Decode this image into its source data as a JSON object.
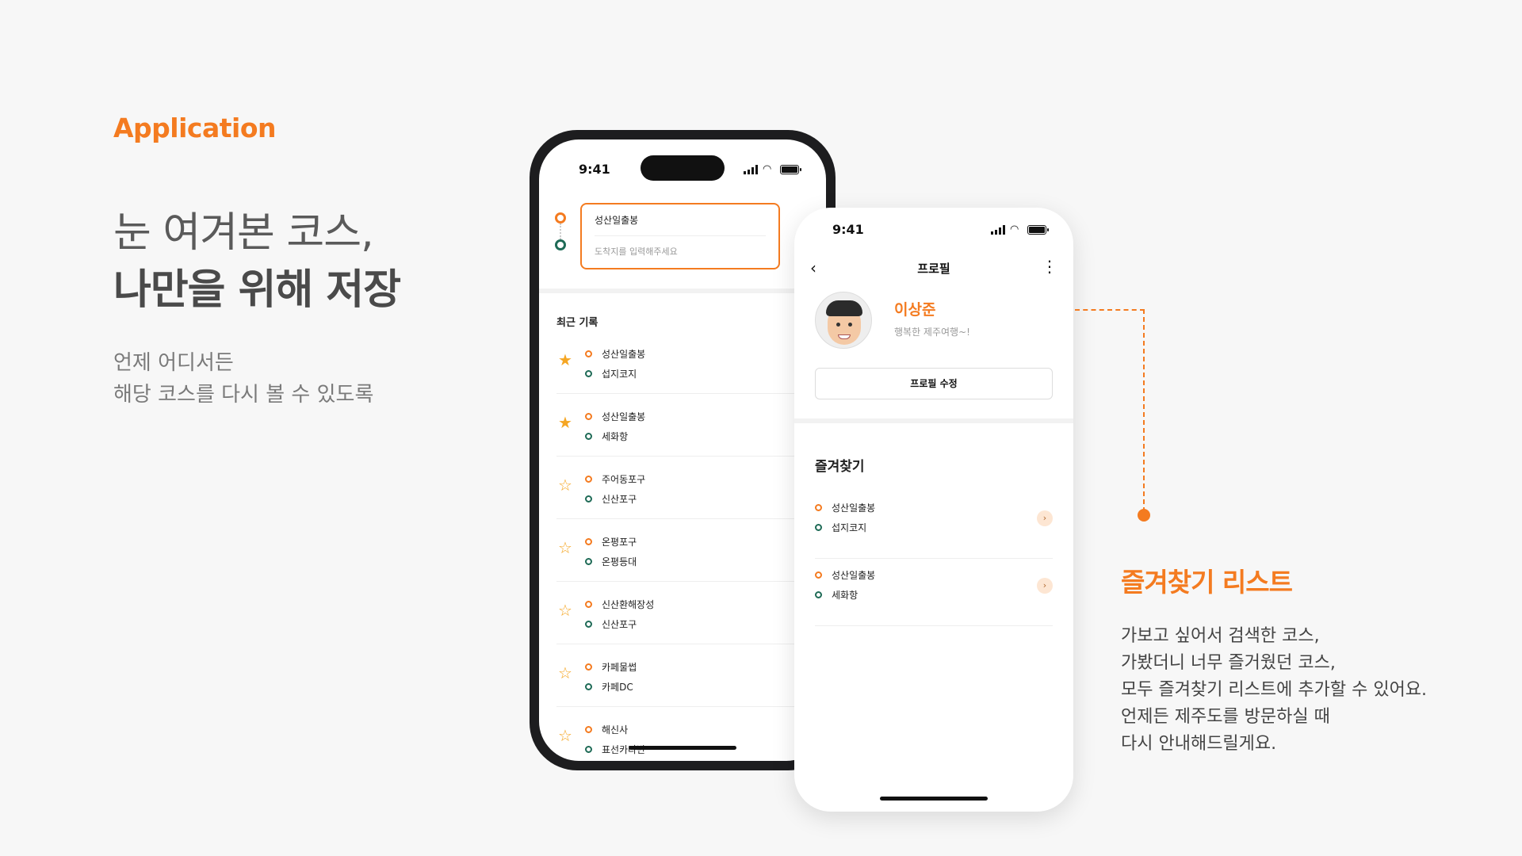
{
  "brand": "Application",
  "headline": {
    "line1": "눈 여겨본 코스,",
    "line2": "나만을 위해 저장"
  },
  "subcopy": {
    "line1": "언제 어디서든",
    "line2": "해당 코스를 다시 볼 수 있도록"
  },
  "colors": {
    "accent": "#f47b20",
    "route_start": "#f47b20",
    "route_end": "#1f6b57",
    "star": "#f5a623"
  },
  "phone1": {
    "time": "9:41",
    "search": {
      "from": "성산일출봉",
      "to_placeholder": "도착지를 입력해주세요",
      "swap_icon": "swap-arrows-icon"
    },
    "recent_title": "최근 기록",
    "recent": [
      {
        "favorite": true,
        "from": "성산일출봉",
        "to": "섭지코지"
      },
      {
        "favorite": true,
        "from": "성산일출봉",
        "to": "세화항"
      },
      {
        "favorite": false,
        "from": "주어동포구",
        "to": "신산포구"
      },
      {
        "favorite": false,
        "from": "온평포구",
        "to": "온평등대"
      },
      {
        "favorite": false,
        "from": "신산환해장성",
        "to": "신산포구"
      },
      {
        "favorite": false,
        "from": "카페물썹",
        "to": "카페DC"
      },
      {
        "favorite": false,
        "from": "해신사",
        "to": "표선카라반"
      }
    ]
  },
  "phone2": {
    "time": "9:41",
    "header_title": "프로필",
    "user": {
      "name": "이상준",
      "bio": "행복한 제주여행~!"
    },
    "edit_button": "프로필 수정",
    "favorites_title": "즐겨찾기",
    "favorites": [
      {
        "from": "성산일출봉",
        "to": "섭지코지"
      },
      {
        "from": "성산일출봉",
        "to": "세화항"
      }
    ]
  },
  "callout": {
    "title": "즐겨찾기 리스트",
    "desc": [
      "가보고 싶어서 검색한 코스,",
      "가봤더니 너무 즐거웠던 코스,",
      "모두 즐겨찾기 리스트에 추가할 수 있어요.",
      "언제든 제주도를 방문하실 때",
      "다시 안내해드릴게요."
    ]
  }
}
